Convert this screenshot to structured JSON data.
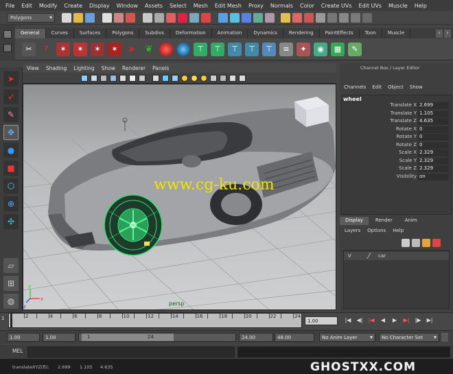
{
  "menubar": [
    "File",
    "Edit",
    "Modify",
    "Create",
    "Display",
    "Window",
    "Assets",
    "Select",
    "Mesh",
    "Edit Mesh",
    "Proxy",
    "Normals",
    "Color",
    "Create UVs",
    "Edit UVs",
    "Muscle",
    "Help"
  ],
  "status": {
    "mode": "Polygons"
  },
  "shelf": {
    "tabs": [
      "General",
      "Curves",
      "Surfaces",
      "Polygons",
      "Subdivs",
      "Deformation",
      "Animation",
      "Dynamics",
      "Rendering",
      "PaintEffects",
      "Toon",
      "Muscle"
    ],
    "active": "General"
  },
  "viewport": {
    "menu": [
      "View",
      "Shading",
      "Lighting",
      "Show",
      "Renderer",
      "Panels"
    ],
    "camera": "persp",
    "axis": {
      "x": "x",
      "y": "y",
      "z": "z"
    }
  },
  "watermark": "www.cg-ku.com",
  "channelbox": {
    "title": "Channel Box / Layer Editor",
    "menu": [
      "Channels",
      "Edit",
      "Object",
      "Show"
    ],
    "object": "wheel",
    "rows": [
      {
        "label": "Translate X",
        "value": "2.699"
      },
      {
        "label": "Translate Y",
        "value": "1.105"
      },
      {
        "label": "Translate Z",
        "value": "4.635"
      },
      {
        "label": "Rotate X",
        "value": "0"
      },
      {
        "label": "Rotate Y",
        "value": "0"
      },
      {
        "label": "Rotate Z",
        "value": "0"
      },
      {
        "label": "Scale X",
        "value": "2.329"
      },
      {
        "label": "Scale Y",
        "value": "2.329"
      },
      {
        "label": "Scale Z",
        "value": "2.329"
      },
      {
        "label": "Visibility",
        "value": "on"
      }
    ]
  },
  "layers": {
    "tabs": [
      "Display",
      "Render",
      "Anim"
    ],
    "active": "Display",
    "menu": [
      "Layers",
      "Options",
      "Help"
    ],
    "items": [
      {
        "v": "V",
        "name": "car"
      }
    ]
  },
  "timeslider": {
    "ticks": [
      "2",
      "4",
      "6",
      "8",
      "10",
      "12",
      "14",
      "16",
      "18",
      "20",
      "22",
      "24"
    ],
    "start_marker": "1",
    "current": "1.00"
  },
  "range": {
    "start": "1.00",
    "start2": "1.00",
    "slider_left": "1",
    "slider_right": "24",
    "end": "24.00",
    "end2": "48.00",
    "anim_layer": "No Anim Layer",
    "char_set": "No Character Set"
  },
  "cmdline": {
    "label": "MEL"
  },
  "helpline": {
    "label": "translateXYZ(ft):",
    "x": "2.699",
    "y": "1.105",
    "z": "4.635"
  },
  "brand": "GHOSTXX.COM",
  "colors": {
    "accent_green": "#35e07a",
    "watermark": "#f2e300",
    "tab_active": "#5b5b5b"
  }
}
